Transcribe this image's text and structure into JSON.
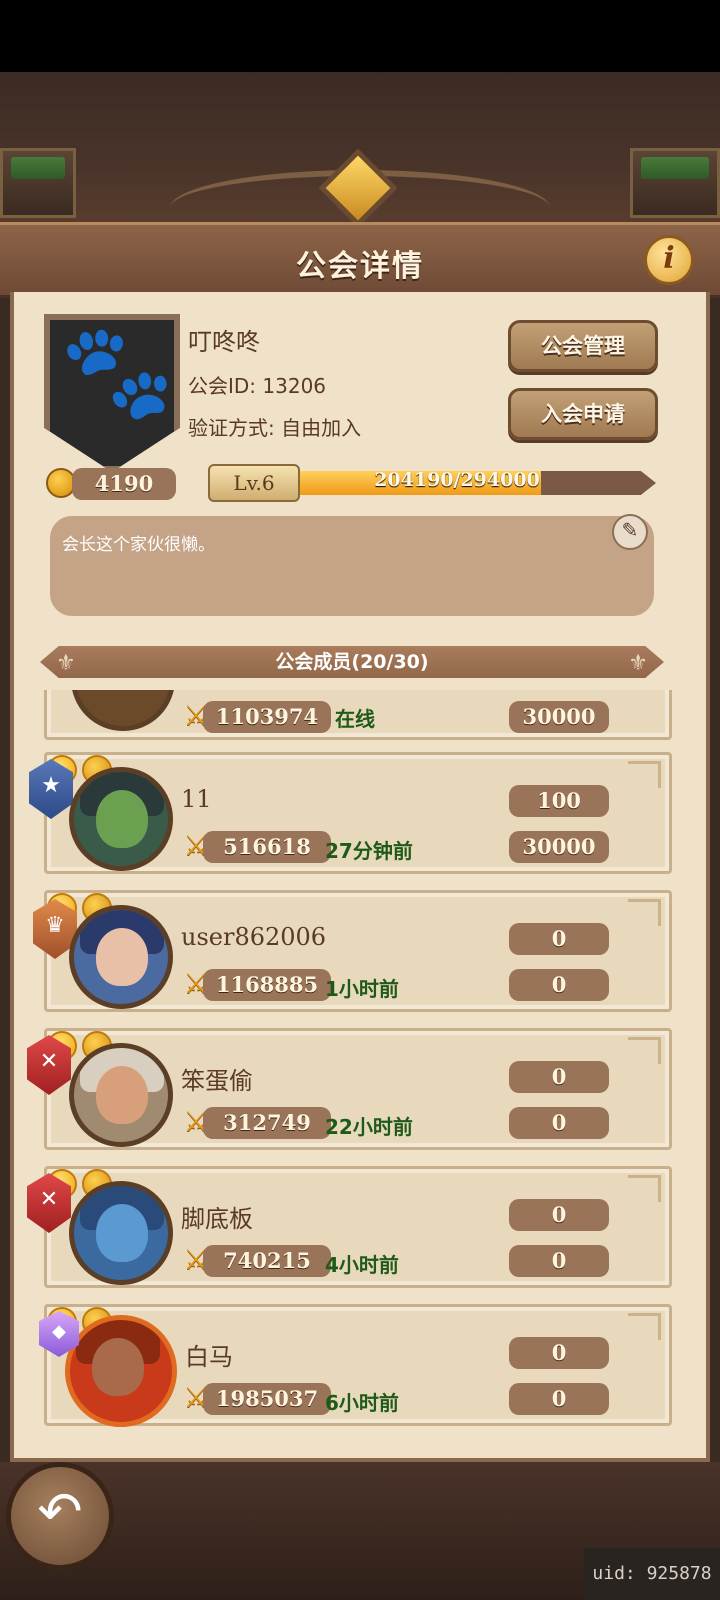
{
  "header": {
    "title": "公会详情",
    "info_label": "i"
  },
  "guild": {
    "name": "叮咚咚",
    "id_text": "公会ID: 13206",
    "verify_text": "验证方式: 自由加入",
    "coins": "4190",
    "level": "Lv.6",
    "xp_text": "204190/294000",
    "xp_progress": 0.6945,
    "notice": "会长这个家伙很懒。"
  },
  "buttons": {
    "manage": "公会管理",
    "apply": "入会申请"
  },
  "members_header": "公会成员(20/30)",
  "members": [
    {
      "name": "",
      "power": "1103974",
      "status": "在线",
      "contrib": "",
      "donate": "30000"
    },
    {
      "name": "11",
      "power": "516618",
      "status": "27分钟前",
      "contrib": "100",
      "donate": "30000"
    },
    {
      "name": "user862006",
      "power": "1168885",
      "status": "1小时前",
      "contrib": "0",
      "donate": "0"
    },
    {
      "name": "笨蛋偷",
      "power": "312749",
      "status": "22小时前",
      "contrib": "0",
      "donate": "0"
    },
    {
      "name": "脚底板",
      "power": "740215",
      "status": "4小时前",
      "contrib": "0",
      "donate": "0"
    },
    {
      "name": "白马",
      "power": "1985037",
      "status": "6小时前",
      "contrib": "0",
      "donate": "0"
    }
  ],
  "uid_text": "uid: 925878",
  "colors": {
    "status_green": "#1f5a1a",
    "accent_gold": "#f0a020"
  }
}
